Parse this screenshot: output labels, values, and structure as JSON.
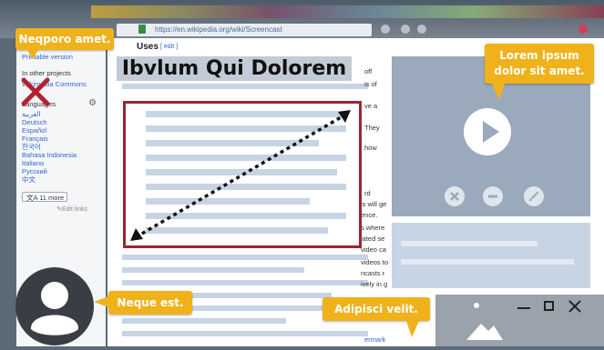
{
  "browser": {
    "url": "https://en.wikipedia.org/wiki/Screencast"
  },
  "sidebar": {
    "print_version": "Printable version",
    "other_projects": "In other projects",
    "wikimedia_commons": "Wikimedia Commons",
    "languages_header": "Languages",
    "languages": [
      "العربية",
      "Deutsch",
      "Español",
      "Français",
      "한국어",
      "Bahasa Indonesia",
      "Italiano",
      "Русский",
      "中文"
    ],
    "more_button": "11 more",
    "edit_links": "Edit links"
  },
  "article": {
    "section_title": "Uses",
    "edit_link": "[ edit ]",
    "right_fragments": [
      "off",
      "is of",
      "ve a",
      "They",
      "how",
      "rd",
      "is will ge",
      "ence.",
      "s where",
      "lated se",
      "video ca",
      "videos to",
      "ncasts r",
      "ively in g",
      "ermark"
    ]
  },
  "overlays": {
    "headline": "Ibvlum Qui Dolorem",
    "callout_top_left": "Neqporo amet.",
    "callout_top_right_line1": "Lorem ipsum",
    "callout_top_right_line2": "dolor sit amet.",
    "callout_avatar": "Neque est.",
    "callout_image": "Adipisci velit."
  },
  "icons": {
    "delete": "x-mark-icon",
    "gear": "gear-icon",
    "play": "play-icon",
    "avatar": "user-avatar-icon",
    "image": "image-icon",
    "minimize": "minimize-icon",
    "maximize": "maximize-icon",
    "close": "close-icon"
  },
  "colors": {
    "callout": "#f0b21b",
    "redbox": "#9d2430",
    "video_panel": "#9aa9bc",
    "link": "#3366cc"
  }
}
